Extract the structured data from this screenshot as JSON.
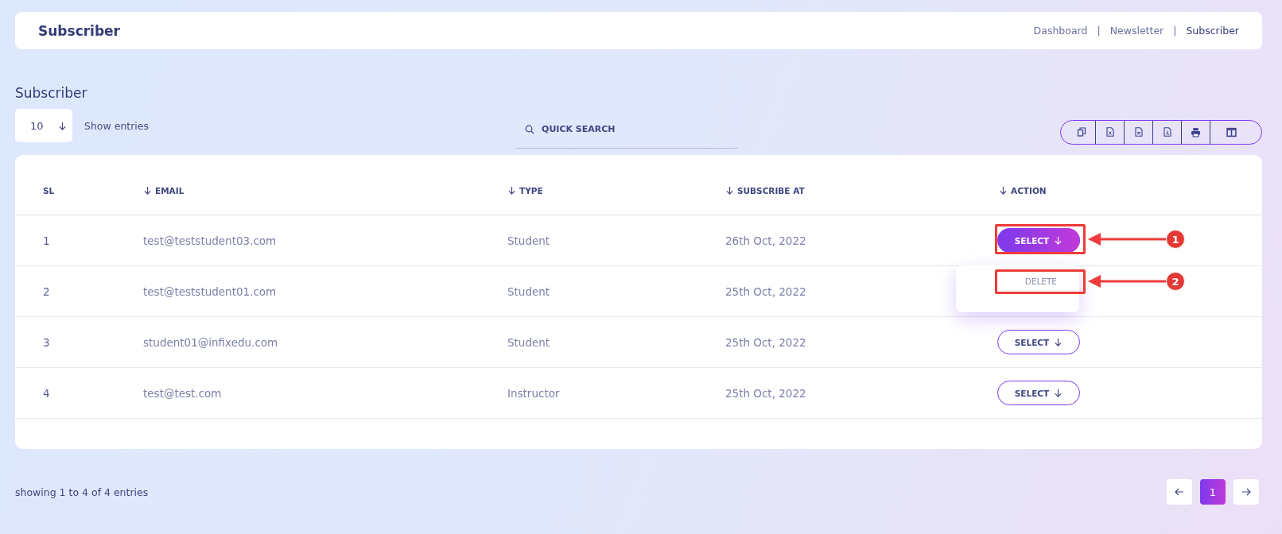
{
  "header": {
    "title": "Subscriber",
    "breadcrumbs": [
      {
        "label": "Dashboard",
        "selected": false
      },
      {
        "separator": "|",
        "label": "Newsletter",
        "selected": false
      },
      {
        "separator": "|",
        "label": "Subscriber",
        "selected": true
      }
    ]
  },
  "section_title": "Subscriber",
  "entries": {
    "value": "10",
    "label": "Show entries"
  },
  "search": {
    "placeholder": "QUICK SEARCH"
  },
  "export_tools": [
    {
      "kind": "copy"
    },
    {
      "kind": "excel"
    },
    {
      "kind": "csv"
    },
    {
      "kind": "pdf"
    },
    {
      "kind": "print"
    },
    {
      "kind": "columns"
    }
  ],
  "table": {
    "columns": [
      {
        "label": "SL",
        "sortable": false
      },
      {
        "label": "EMAIL",
        "sortable": true
      },
      {
        "label": "TYPE",
        "sortable": true
      },
      {
        "label": "SUBSCRIBE AT",
        "sortable": true
      },
      {
        "label": "ACTION",
        "sortable": true
      }
    ],
    "rows": [
      {
        "sl": "1",
        "email": "test@teststudent03.com",
        "type": "Student",
        "subscribed_at": "26th Oct, 2022",
        "action": {
          "label": "SELECT",
          "open": true,
          "menu": [
            "DELETE"
          ]
        }
      },
      {
        "sl": "2",
        "email": "test@teststudent01.com",
        "type": "Student",
        "subscribed_at": "25th Oct, 2022"
      },
      {
        "sl": "3",
        "email": "student01@infixedu.com",
        "type": "Student",
        "subscribed_at": "25th Oct, 2022",
        "action": {
          "label": "SELECT",
          "open": false
        }
      },
      {
        "sl": "4",
        "email": "test@test.com",
        "type": "Instructor",
        "subscribed_at": "25th Oct, 2022",
        "action": {
          "label": "SELECT",
          "open": false
        }
      }
    ]
  },
  "footer": {
    "summary": "showing 1 to 4 of 4 entries",
    "pages": [
      {
        "label": "1",
        "selected": true
      }
    ]
  },
  "annotations": [
    {
      "number": "1"
    },
    {
      "number": "2"
    }
  ]
}
